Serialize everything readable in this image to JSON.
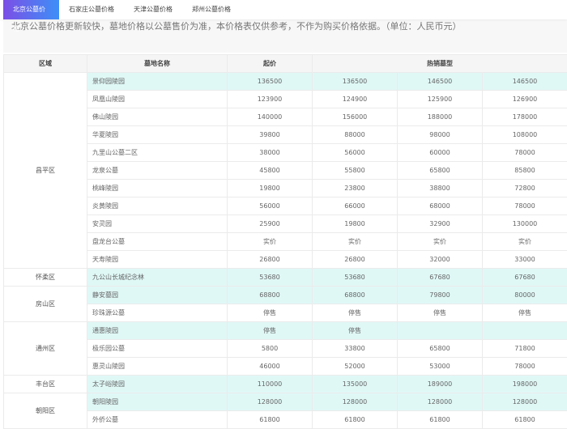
{
  "tabs": [
    {
      "label": "北京公墓价格",
      "active": true
    },
    {
      "label": "石家庄公墓价格"
    },
    {
      "label": "天津公墓价格"
    },
    {
      "label": "郑州公墓价格"
    }
  ],
  "notice": "北京公墓价格更新较快，墓地价格以公墓售价为准，本价格表仅供参考，不作为购买价格依据。（单位：人民币元）",
  "table": {
    "headers": {
      "region": "区域",
      "name": "墓地名称",
      "start": "起价",
      "hot": "热销墓型"
    },
    "groups": [
      {
        "region": "昌平区",
        "rows": [
          {
            "name": "景仰园陵园",
            "prices": [
              "136500",
              "136500",
              "146500",
              "146500"
            ],
            "hl": true
          },
          {
            "name": "凤凰山陵园",
            "prices": [
              "123900",
              "124900",
              "125900",
              "126900"
            ]
          },
          {
            "name": "佛山陵园",
            "prices": [
              "140000",
              "156000",
              "188000",
              "178000"
            ]
          },
          {
            "name": "华夏陵园",
            "prices": [
              "39800",
              "88000",
              "98000",
              "108000"
            ]
          },
          {
            "name": "九里山公墓二区",
            "prices": [
              "38000",
              "56000",
              "60000",
              "78000"
            ]
          },
          {
            "name": "龙泉公墓",
            "prices": [
              "45800",
              "55800",
              "65800",
              "85800"
            ]
          },
          {
            "name": "桃峰陵园",
            "prices": [
              "19800",
              "23800",
              "38800",
              "72800"
            ]
          },
          {
            "name": "炎黄陵园",
            "prices": [
              "56000",
              "66000",
              "68000",
              "78000"
            ]
          },
          {
            "name": "安灵园",
            "prices": [
              "25900",
              "19800",
              "32900",
              "130000"
            ]
          },
          {
            "name": "盘龙台公墓",
            "prices": [
              "实价",
              "实价",
              "实价",
              "实价"
            ]
          },
          {
            "name": "天寿陵园",
            "prices": [
              "26800",
              "26800",
              "32000",
              "33000"
            ]
          }
        ]
      },
      {
        "region": "怀柔区",
        "rows": [
          {
            "name": "九公山长城纪念林",
            "prices": [
              "53680",
              "53680",
              "67680",
              "67680"
            ],
            "hl": true
          }
        ]
      },
      {
        "region": "房山区",
        "rows": [
          {
            "name": "静安墓园",
            "prices": [
              "68800",
              "68800",
              "79800",
              "80000"
            ],
            "hl": true
          },
          {
            "name": "珍珠源公墓",
            "prices": [
              "停售",
              "停售",
              "停售",
              "停售"
            ]
          }
        ]
      },
      {
        "region": "通州区",
        "rows": [
          {
            "name": "通惠陵园",
            "prices": [
              "停售",
              "停售",
              "",
              ""
            ],
            "hl": true
          },
          {
            "name": "极乐园公墓",
            "prices": [
              "5800",
              "33800",
              "65800",
              "71800"
            ]
          },
          {
            "name": "惠灵山陵园",
            "prices": [
              "46000",
              "52000",
              "53000",
              "78000"
            ]
          }
        ]
      },
      {
        "region": "丰台区",
        "rows": [
          {
            "name": "太子峪陵园",
            "prices": [
              "110000",
              "135000",
              "189000",
              "198000"
            ],
            "hl": true
          }
        ]
      },
      {
        "region": "朝阳区",
        "rows": [
          {
            "name": "朝阳陵园",
            "prices": [
              "128000",
              "128000",
              "128000",
              "128000"
            ],
            "hl": true
          },
          {
            "name": "外侨公墓",
            "prices": [
              "61800",
              "61800",
              "61800",
              "61800"
            ]
          }
        ]
      }
    ]
  }
}
